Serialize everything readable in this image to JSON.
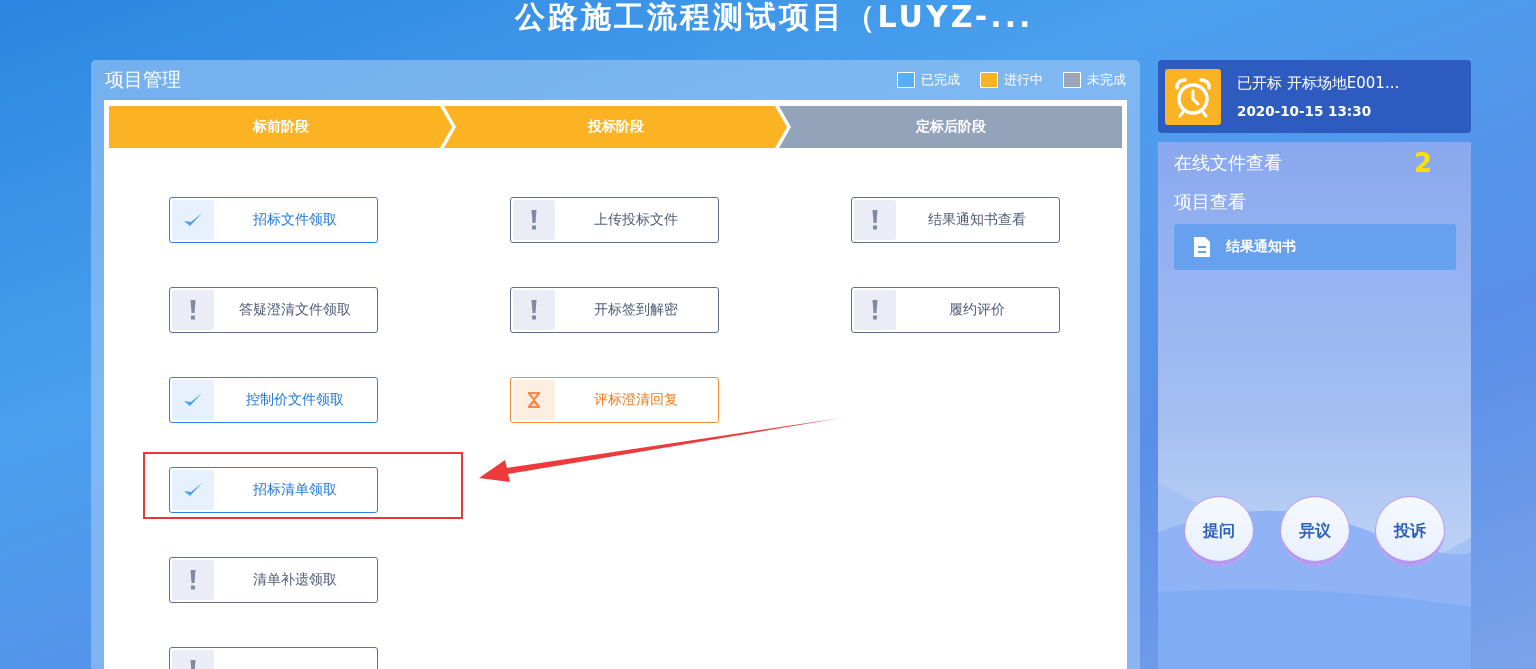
{
  "title": "公路施工流程测试项目（LUYZ-...",
  "panel": {
    "title": "项目管理",
    "legend": [
      {
        "label": "已完成",
        "color": "#56b0f5"
      },
      {
        "label": "进行中",
        "color": "#fbb323"
      },
      {
        "label": "未完成",
        "color": "#9aa6b8"
      }
    ],
    "stages": [
      {
        "label": "标前阶段",
        "kind": "active"
      },
      {
        "label": "投标阶段",
        "kind": "active"
      },
      {
        "label": "定标后阶段",
        "kind": "pending"
      }
    ],
    "task_columns": [
      [
        {
          "label": "招标文件领取",
          "kind": "done"
        },
        {
          "label": "答疑澄清文件领取",
          "kind": "pending"
        },
        {
          "label": "控制价文件领取",
          "kind": "done"
        },
        {
          "label": "招标清单领取",
          "kind": "done"
        },
        {
          "label": "清单补遗领取",
          "kind": "pending"
        },
        {
          "kind": "pending"
        }
      ],
      [
        {
          "label": "上传投标文件",
          "kind": "pending"
        },
        {
          "label": "开标签到解密",
          "kind": "pending"
        },
        {
          "label": "评标澄清回复",
          "kind": "active"
        }
      ],
      [
        {
          "label": "结果通知书查看",
          "kind": "pending"
        },
        {
          "label": "履约评价",
          "kind": "pending"
        }
      ]
    ]
  },
  "notice": {
    "text": "已开标 开标场地E001...",
    "time": "2020-10-15 13:30"
  },
  "side": {
    "online_files": "在线文件查看",
    "count": "2",
    "project_view": "项目查看",
    "link": "结果通知书",
    "actions": [
      "提问",
      "异议",
      "投诉"
    ]
  }
}
